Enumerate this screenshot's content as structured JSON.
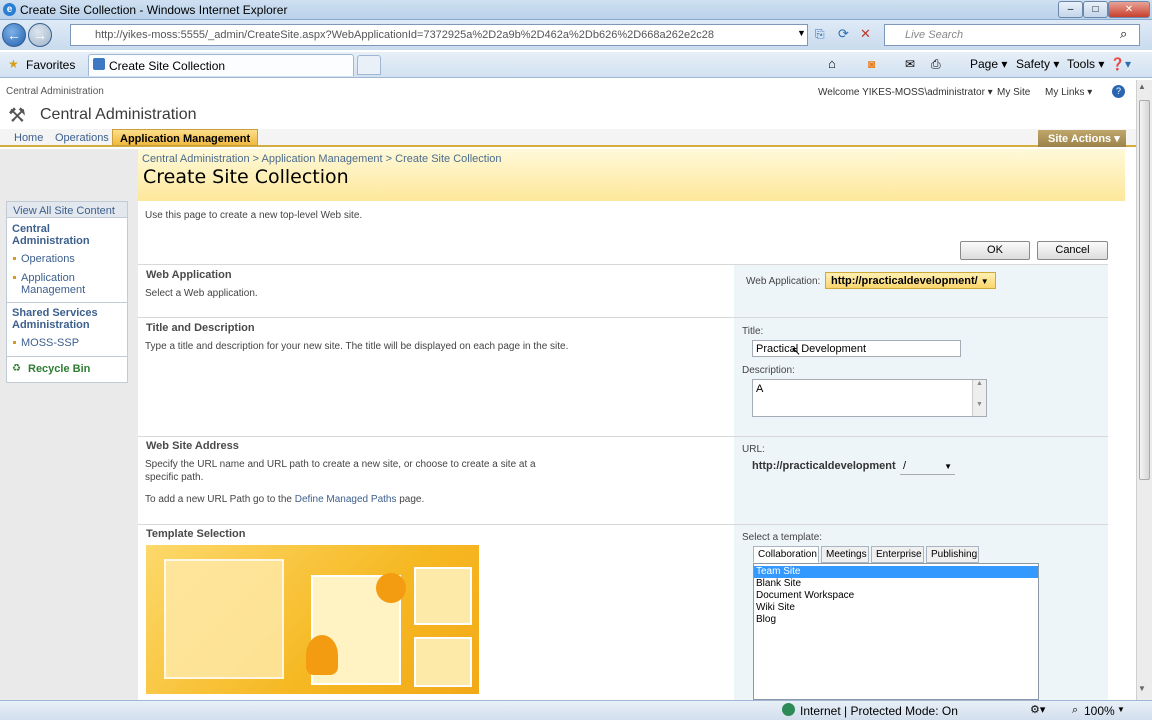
{
  "window": {
    "title": "Create Site Collection - Windows Internet Explorer"
  },
  "browser": {
    "address": "http://yikes-moss:5555/_admin/CreateSite.aspx?WebApplicationId=7372925a%2D2a9b%2D462a%2Db626%2D668a262e2c28",
    "search_placeholder": "Live Search",
    "favorites_label": "Favorites",
    "tab_title": "Create Site Collection",
    "commands": [
      "Page",
      "Safety",
      "Tools"
    ]
  },
  "sp": {
    "breadcrumb_top": "Central Administration",
    "welcome": "Welcome YIKES-MOSS\\administrator",
    "my_site": "My Site",
    "my_links": "My Links",
    "site_title": "Central Administration",
    "nav": [
      "Home",
      "Operations",
      "Application Management"
    ],
    "site_actions": "Site Actions",
    "breadcrumb": "Central Administration > Application Management > Create Site Collection",
    "page_title": "Create Site Collection",
    "intro": "Use this page to create a new top-level Web site.",
    "ok": "OK",
    "cancel": "Cancel"
  },
  "quicklaunch": {
    "view_all": "View All Site Content",
    "central_admin": "Central Administration",
    "operations": "Operations",
    "app_mgmt": "Application Management",
    "ssa": "Shared Services Administration",
    "moss_ssp": "MOSS-SSP",
    "recycle": "Recycle Bin"
  },
  "sections": {
    "webapp": {
      "head": "Web Application",
      "desc": "Select a Web application.",
      "label": "Web Application:",
      "value": "http://practicaldevelopment/"
    },
    "title": {
      "head": "Title and Description",
      "desc": "Type a title and description for your new site. The title will be displayed on each page in the site.",
      "title_label": "Title:",
      "title_value": "Practical Development",
      "desc_label": "Description:",
      "desc_value": "A"
    },
    "address": {
      "head": "Web Site Address",
      "desc": "Specify the URL name and URL path to create a new site, or choose to create a site at a specific path.",
      "desc2_pre": "To add a new URL Path go to the ",
      "desc2_link": "Define Managed Paths",
      "desc2_post": " page.",
      "url_label": "URL:",
      "url_value": "http://practicaldevelopment",
      "path_value": "/"
    },
    "template": {
      "head": "Template Selection",
      "select_label": "Select a template:",
      "tabs": [
        "Collaboration",
        "Meetings",
        "Enterprise",
        "Publishing"
      ],
      "items": [
        "Team Site",
        "Blank Site",
        "Document Workspace",
        "Wiki Site",
        "Blog"
      ]
    }
  },
  "status": {
    "zone": "Internet | Protected Mode: On",
    "zoom": "100%"
  }
}
